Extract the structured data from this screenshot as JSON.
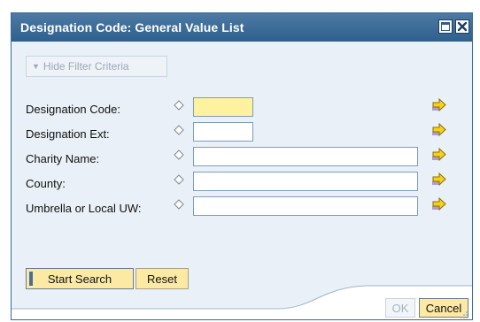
{
  "dialog": {
    "title": "Designation Code: General Value List",
    "filter_toggle_label": "Hide Filter Criteria",
    "fields": [
      {
        "label": "Designation Code:",
        "value": "",
        "highlighted": true
      },
      {
        "label": "Designation Ext:",
        "value": "",
        "highlighted": false
      },
      {
        "label": "Charity Name:",
        "value": "",
        "highlighted": false
      },
      {
        "label": "County:",
        "value": "",
        "highlighted": false
      },
      {
        "label": "Umbrella or Local UW:",
        "value": "",
        "highlighted": false
      }
    ],
    "start_search_label": "Start Search",
    "reset_label": "Reset",
    "ok_label": "OK",
    "cancel_label": "Cancel"
  },
  "colors": {
    "title_bar": "#3a6a96",
    "dialog_bg": "#e9f0f7",
    "button_yellow": "#fbe9a4",
    "highlight_field": "#fff29e",
    "arrow_yellow": "#f5d21a"
  },
  "icons": {
    "window": [
      "maximize-icon",
      "close-icon"
    ],
    "field_prefix": "diamond-icon",
    "field_go": "arrow-right-icon",
    "filter_toggle": "triangle-down-icon",
    "resize": "resize-grip-icon"
  }
}
